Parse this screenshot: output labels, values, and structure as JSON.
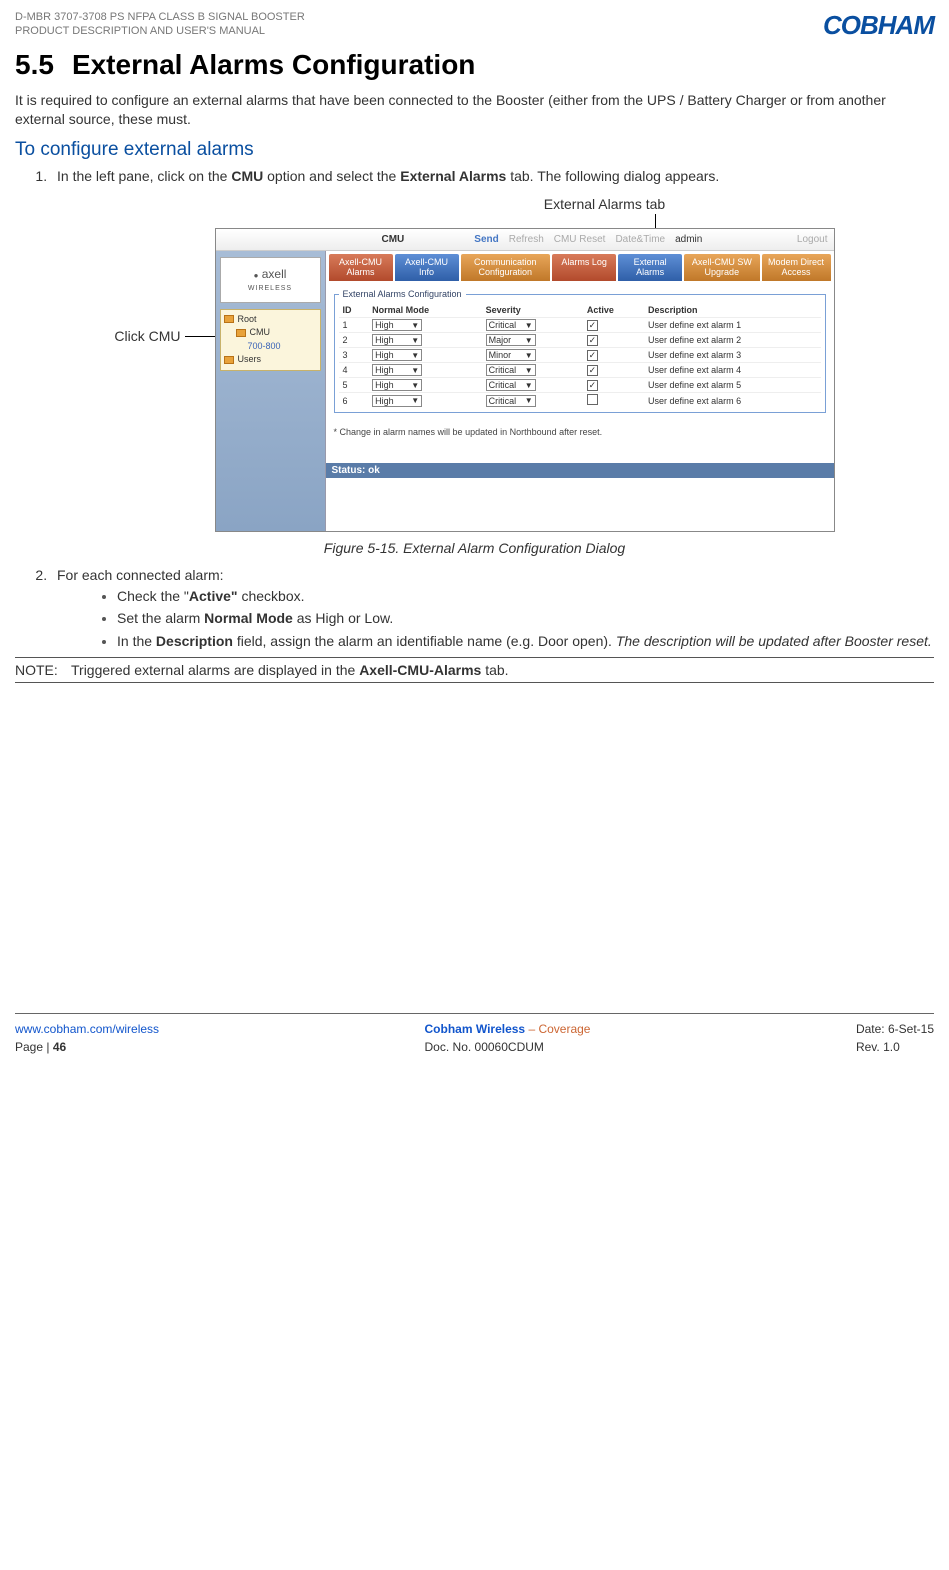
{
  "header": {
    "line1": "D-MBR 3707-3708 PS NFPA CLASS B SIGNAL BOOSTER",
    "line2": "PRODUCT DESCRIPTION AND USER'S MANUAL",
    "logo": "COBHAM"
  },
  "section": {
    "num": "5.5",
    "title": "External Alarms Configuration",
    "intro": "It is required to configure an external alarms that have been connected to the Booster (either from the UPS / Battery Charger or from another external source, these must.",
    "subhead": "To configure external alarms",
    "step1_a": "In the left pane, click on the ",
    "step1_b": "CMU",
    "step1_c": " option and select the ",
    "step1_d": "External Alarms",
    "step1_e": " tab. The following dialog appears.",
    "step2": "For each connected alarm:",
    "b1_a": "Check the \"",
    "b1_b": "Active\"",
    "b1_c": " checkbox.",
    "b2_a": "Set the alarm ",
    "b2_b": "Normal Mode",
    "b2_c": " as High or Low.",
    "b3_a": "In the ",
    "b3_b": "Description",
    "b3_c": " field, assign the alarm an identifiable name (e.g. Door open). ",
    "b3_d": "The description will be updated after Booster reset."
  },
  "callouts": {
    "top": "External Alarms tab",
    "left": "Click CMU"
  },
  "screenshot": {
    "topbar": {
      "cmu": "CMU",
      "send": "Send",
      "refresh": "Refresh",
      "cmu_reset": "CMU Reset",
      "date_time": "Date&Time",
      "admin": "admin",
      "logout": "Logout"
    },
    "logo": {
      "name": "axell",
      "sub": "WIRELESS"
    },
    "tree": {
      "root": "Root",
      "cmu": "CMU",
      "band": "700-800",
      "users": "Users"
    },
    "tabs": [
      {
        "label": "Axell-CMU Alarms",
        "cls": "red"
      },
      {
        "label": "Axell-CMU Info",
        "cls": "blue"
      },
      {
        "label": "Communication Configuration",
        "cls": "orange"
      },
      {
        "label": "Alarms Log",
        "cls": "red"
      },
      {
        "label": "External Alarms",
        "cls": "blue"
      },
      {
        "label": "Axell-CMU SW Upgrade",
        "cls": "orange"
      },
      {
        "label": "Modem Direct Access",
        "cls": "orange"
      }
    ],
    "fieldset_legend": "External Alarms Configuration",
    "table": {
      "headers": {
        "id": "ID",
        "normal": "Normal Mode",
        "severity": "Severity",
        "active": "Active",
        "desc": "Description"
      },
      "rows": [
        {
          "id": "1",
          "normal": "High",
          "severity": "Critical",
          "active": true,
          "desc": "User define ext alarm 1"
        },
        {
          "id": "2",
          "normal": "High",
          "severity": "Major",
          "active": true,
          "desc": "User define ext alarm 2"
        },
        {
          "id": "3",
          "normal": "High",
          "severity": "Minor",
          "active": true,
          "desc": "User define ext alarm 3"
        },
        {
          "id": "4",
          "normal": "High",
          "severity": "Critical",
          "active": true,
          "desc": "User define ext alarm 4"
        },
        {
          "id": "5",
          "normal": "High",
          "severity": "Critical",
          "active": true,
          "desc": "User define ext alarm 5"
        },
        {
          "id": "6",
          "normal": "High",
          "severity": "Critical",
          "active": false,
          "desc": "User define ext alarm 6"
        }
      ]
    },
    "note": "* Change in alarm names will be updated in Northbound after reset.",
    "status": "Status: ok"
  },
  "figure_caption": "Figure 5-15. External Alarm Configuration Dialog",
  "note_block": {
    "label": "NOTE:",
    "text_a": "Triggered external alarms are displayed in the ",
    "text_b": "Axell-CMU-Alarms",
    "text_c": " tab."
  },
  "footer": {
    "url": "www.cobham.com/wireless",
    "page": "Page | 46",
    "brand": "Cobham Wireless",
    "dash_cov": " – Coverage",
    "doc": "Doc. No. 00060CDUM",
    "date": "Date: 6-Set-15",
    "rev": "Rev. 1.0"
  }
}
